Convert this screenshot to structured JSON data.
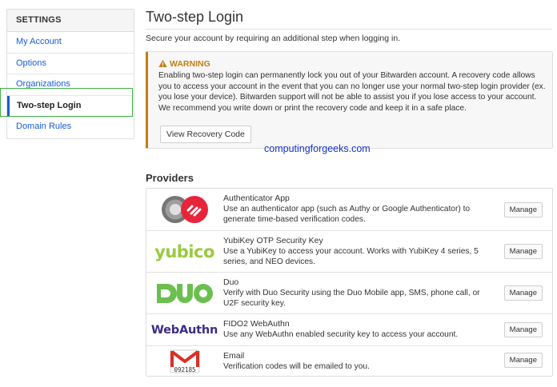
{
  "sidebar": {
    "header": "SETTINGS",
    "items": [
      {
        "label": "My Account"
      },
      {
        "label": "Options"
      },
      {
        "label": "Organizations"
      },
      {
        "label": "Two-step Login"
      },
      {
        "label": "Domain Rules"
      }
    ],
    "active_index": 3
  },
  "page": {
    "title": "Two-step Login",
    "intro": "Secure your account by requiring an additional step when logging in."
  },
  "warning": {
    "title": "WARNING",
    "text": "Enabling two-step login can permanently lock you out of your Bitwarden account. A recovery code allows you to access your account in the event that you can no longer use your normal two-step login provider (ex. you lose your device). Bitwarden support will not be able to assist you if you lose access to your account. We recommend you write down or print the recovery code and keep it in a safe place.",
    "button_label": "View Recovery Code",
    "accent_color": "#bf7e16"
  },
  "watermark": "computingforgeeks.com",
  "providers": {
    "heading": "Providers",
    "items": [
      {
        "name": "Authenticator App",
        "description": "Use an authenticator app (such as Authy or Google Authenticator) to generate time-based verification codes.",
        "icon": "authenticator-logo",
        "manage_label": "Manage"
      },
      {
        "name": "YubiKey OTP Security Key",
        "description": "Use a YubiKey to access your account. Works with YubiKey 4 series, 5 series, and NEO devices.",
        "icon": "yubico-logo",
        "logo_text": "yubico",
        "manage_label": "Manage"
      },
      {
        "name": "Duo",
        "description": "Verify with Duo Security using the Duo Mobile app, SMS, phone call, or U2F security key.",
        "icon": "duo-logo",
        "manage_label": "Manage"
      },
      {
        "name": "FIDO2 WebAuthn",
        "description": "Use any WebAuthn enabled security key to access your account.",
        "icon": "webauthn-logo",
        "logo_text": "WebAuthn",
        "manage_label": "Manage"
      },
      {
        "name": "Email",
        "description": "Verification codes will be emailed to you.",
        "icon": "email-logo",
        "logo_code": "092185",
        "manage_label": "Manage"
      }
    ]
  },
  "colors": {
    "link": "#175ddc",
    "active_outline": "#3cb043",
    "yubico_green": "#9aca3c",
    "duo_green": "#6bbf4e",
    "webauthn_purple": "#3a2d86",
    "authy_red": "#e8243b",
    "gmail_red": "#d93025"
  }
}
